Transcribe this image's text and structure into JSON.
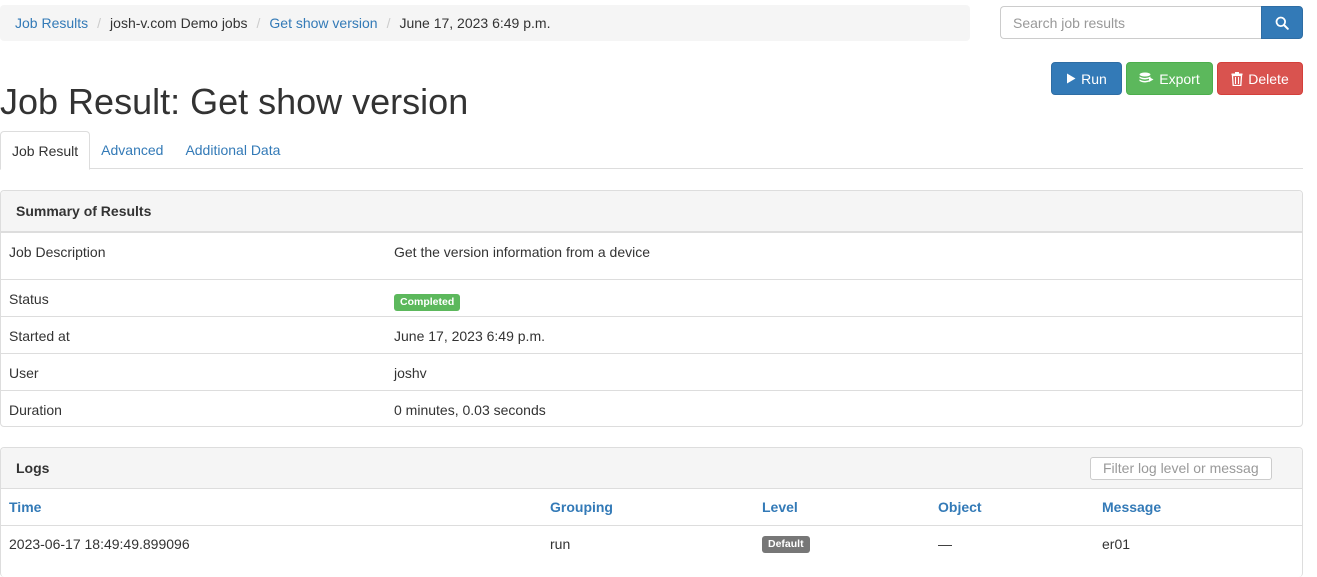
{
  "breadcrumb": {
    "items": [
      {
        "label": "Job Results"
      },
      {
        "label": "josh-v.com Demo jobs"
      },
      {
        "label": "Get show version"
      },
      {
        "label": "June 17, 2023 6:49 p.m."
      }
    ],
    "separator": "/"
  },
  "search": {
    "placeholder": "Search job results",
    "value": "",
    "icon": "search-icon"
  },
  "actions": {
    "run_label": "Run",
    "export_label": "Export",
    "delete_label": "Delete"
  },
  "page": {
    "title": "Job Result: Get show version"
  },
  "tabs": [
    {
      "label": "Job Result",
      "active": true
    },
    {
      "label": "Advanced",
      "active": false
    },
    {
      "label": "Additional Data",
      "active": false
    }
  ],
  "summary": {
    "heading": "Summary of Results",
    "rows": {
      "description": {
        "key": "Job Description",
        "value": "Get the version information from a device"
      },
      "status": {
        "key": "Status",
        "value": "Completed"
      },
      "started": {
        "key": "Started at",
        "value": "June 17, 2023 6:49 p.m."
      },
      "user": {
        "key": "User",
        "value": "joshv"
      },
      "duration": {
        "key": "Duration",
        "value": "0 minutes, 0.03 seconds"
      }
    }
  },
  "logs": {
    "heading": "Logs",
    "filter_placeholder": "Filter log level or messag",
    "columns": [
      "Time",
      "Grouping",
      "Level",
      "Object",
      "Message"
    ],
    "rows": [
      {
        "time": "2023-06-17 18:49:49.899096",
        "grouping": "run",
        "level": "Default",
        "object": "—",
        "message": "er01"
      }
    ]
  },
  "colors": {
    "primary": "#337ab7",
    "success": "#5cb85c",
    "danger": "#d9534f",
    "default_badge": "#777777"
  }
}
